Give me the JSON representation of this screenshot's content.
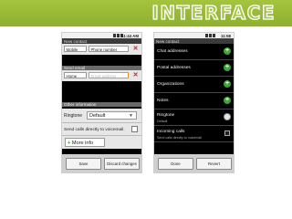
{
  "banner": {
    "title": "INTERFACE"
  },
  "left_phone": {
    "status_time": "11:44 AM",
    "title": "New contact",
    "fields": [
      {
        "section": "Phone",
        "type": "Mobile",
        "placeholder": "Phone number"
      },
      {
        "section": "Send email",
        "type": "Home",
        "placeholder": "Email address"
      }
    ],
    "other_section": "Other information",
    "ringtone_label": "Ringtone",
    "ringtone_value": "Default",
    "voicemail_label": "Send calls directly to voicemail.",
    "more_info_label": "More info",
    "save_label": "Save",
    "discard_label": "Discard changes"
  },
  "right_phone": {
    "status_time": "11:58",
    "title": "New contact",
    "items": [
      {
        "label": "Chat addresses"
      },
      {
        "label": "Postal addresses"
      },
      {
        "label": "Organizations"
      },
      {
        "label": "Notes"
      }
    ],
    "ringtone_label": "Ringtone",
    "ringtone_value": "Default",
    "incoming_label": "Incoming calls",
    "incoming_sub": "Send calls directly to voicemail",
    "done_label": "Done",
    "revert_label": "Revert"
  }
}
